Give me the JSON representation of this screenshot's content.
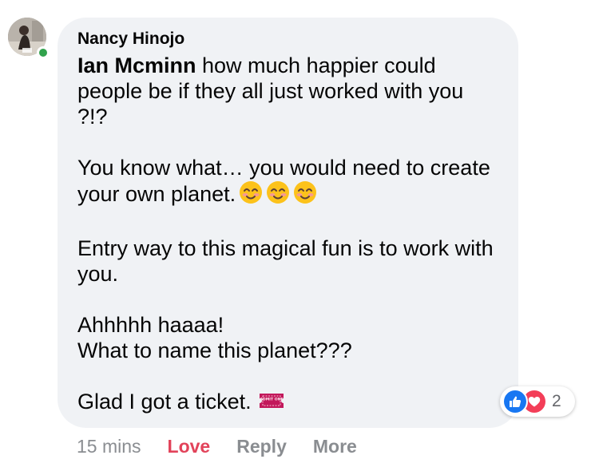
{
  "comment": {
    "author": "Nancy Hinojo",
    "mention": "Ian Mcminn",
    "line1_rest": " how much happier could people be if they all just worked with you ?!?",
    "para2_text": "You know what… you would need to create your own planet.",
    "para2_emoji": "smiling-face-with-smiling-eyes-icon",
    "para3_text": "Entry way to this magical fun is to work with you.",
    "para4_line1": "Ahhhhh haaaa!",
    "para4_line2": "What to name this planet???",
    "para5_text": "Glad I got a ticket.",
    "para5_emoji": "admission-ticket-icon",
    "ticket_text": "ADMIT ONE"
  },
  "reactions": {
    "icons": [
      "like-icon",
      "love-icon"
    ],
    "count": "2"
  },
  "actions": {
    "timestamp": "15 mins",
    "love_label": "Love",
    "reply_label": "Reply",
    "more_label": "More"
  },
  "colors": {
    "bubble_bg": "#f0f2f5",
    "love_accent": "#e2435a",
    "like_blue": "#1877f2",
    "online_green": "#31a24c",
    "muted_text": "#8a8d91"
  },
  "user": {
    "online": true
  }
}
